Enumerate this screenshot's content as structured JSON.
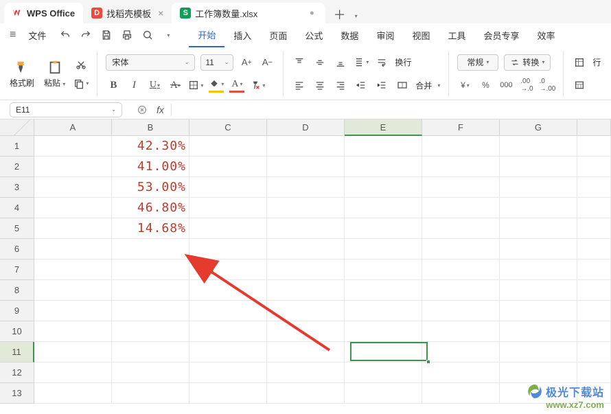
{
  "tabs": {
    "home": "WPS Office",
    "dao": "找稻壳模板",
    "workbook": "工作簿数量.xlsx"
  },
  "file": {
    "label": "文件"
  },
  "menu": {
    "start": "开始",
    "insert": "插入",
    "page": "页面",
    "formula": "公式",
    "data": "数据",
    "review": "审阅",
    "view": "视图",
    "tools": "工具",
    "member": "会员专享",
    "effic": "效率"
  },
  "ribbon": {
    "format_painter": "格式刷",
    "paste": "粘贴",
    "font_name": "宋体",
    "font_size": "11",
    "wrap": "换行",
    "merge": "合并",
    "num_format": "常规",
    "transform": "转换",
    "row_col": "行"
  },
  "formula_bar": {
    "namebox": "E11",
    "fx": "fx"
  },
  "grid": {
    "cols": [
      "A",
      "B",
      "C",
      "D",
      "E",
      "F",
      "G"
    ],
    "rows": [
      "1",
      "2",
      "3",
      "4",
      "5",
      "6",
      "7",
      "8",
      "9",
      "10",
      "11",
      "12",
      "13"
    ],
    "active_col_index": 4,
    "active_row_index": 10,
    "b_values": [
      "42.30%",
      "41.00%",
      "53.00%",
      "46.80%",
      "14.68%"
    ]
  },
  "watermark": {
    "line1": "极光下载站",
    "line2": "www.xz7.com"
  }
}
